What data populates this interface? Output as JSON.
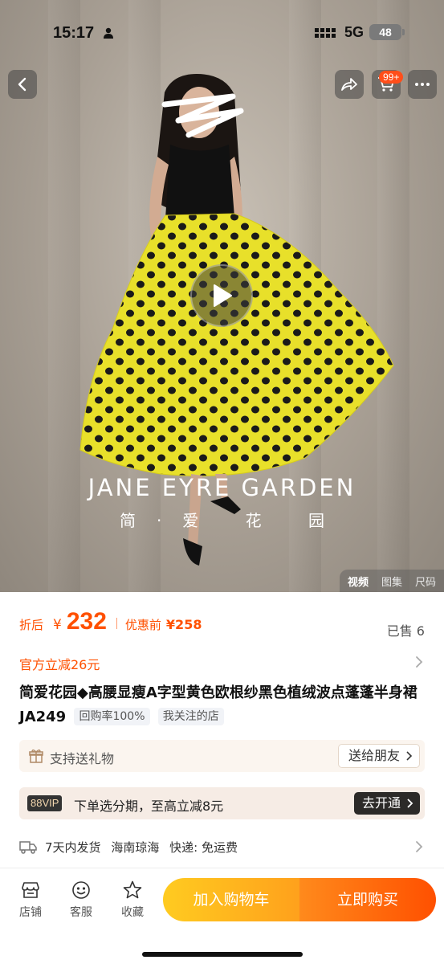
{
  "status": {
    "time": "15:17",
    "network": "5G",
    "battery": "48"
  },
  "header": {
    "cart_badge": "99+"
  },
  "hero": {
    "brand_en": "JANE EYRE GARDEN",
    "brand_cn": "简·爱 花 园",
    "media_tabs": [
      "视频",
      "图集",
      "尺码"
    ]
  },
  "price": {
    "after_label": "折后",
    "currency": "¥",
    "value": "232",
    "before_label": "优惠前",
    "before_value": "¥258",
    "sold": "已售 6"
  },
  "coupon": "官方立减26元",
  "title": "简爱花园◆高腰显瘦A字型黄色欧根纱黑色植绒波点蓬蓬半身裙 JA249",
  "tags": [
    "回购率100%",
    "我关注的店"
  ],
  "gift": {
    "text": "支持送礼物",
    "button": "送给朋友"
  },
  "vip": {
    "badge": "88VIP",
    "text": "下单选分期，至高立减8元",
    "button": "去开通"
  },
  "shipping": {
    "items": [
      "7天内发货",
      "海南琼海",
      "快递: 免运费"
    ]
  },
  "bottom": {
    "nav": [
      "店铺",
      "客服",
      "收藏"
    ],
    "add_cart": "加入购物车",
    "buy_now": "立即购买"
  },
  "colors": {
    "accent": "#ff5000",
    "cart_button": "#ffb21e",
    "skirt_yellow": "#e8e02a"
  }
}
